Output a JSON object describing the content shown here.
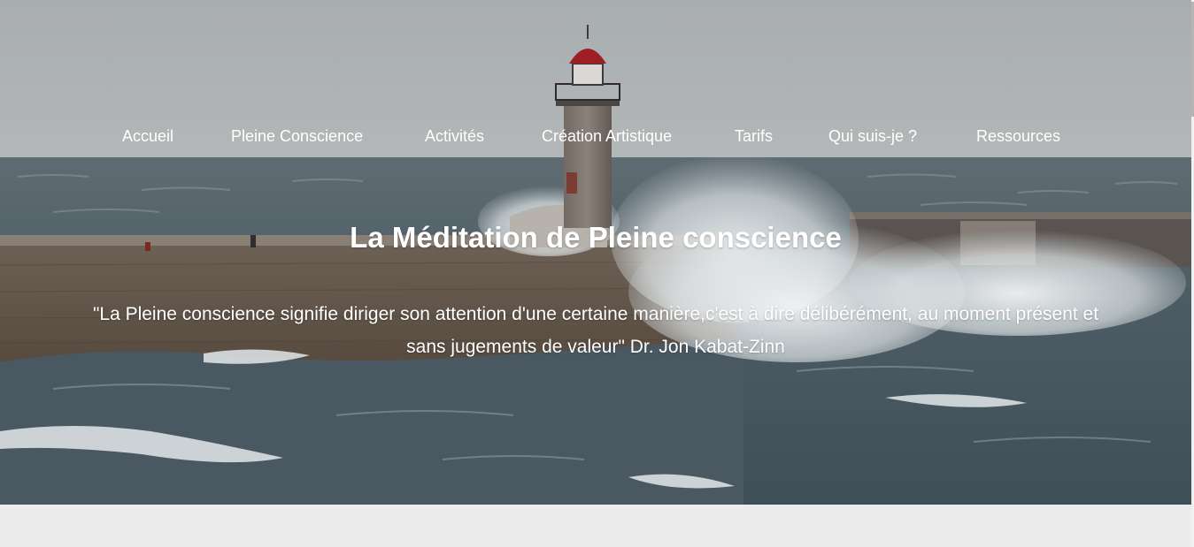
{
  "nav": {
    "items": [
      {
        "label": "Accueil"
      },
      {
        "label": "Pleine Conscience"
      },
      {
        "label": "Activités"
      },
      {
        "label": "Création Artistique"
      },
      {
        "label": "Tarifs"
      },
      {
        "label": "Qui suis-je ?"
      },
      {
        "label": "Ressources"
      }
    ]
  },
  "hero": {
    "title": "La Méditation de Pleine conscience",
    "quote": "\"La Pleine conscience signifie diriger son attention d'une certaine manière,c'est à dire délibérément, au moment présent et sans jugements de valeur\" Dr. Jon Kabat-Zinn"
  },
  "colors": {
    "sky": "#a9aeb0",
    "sea": "#4d5d66",
    "foam": "#e8ecee",
    "pier": "#6b5e52",
    "lighthouse_roof": "#9d1e24",
    "page_background": "#ececec"
  }
}
